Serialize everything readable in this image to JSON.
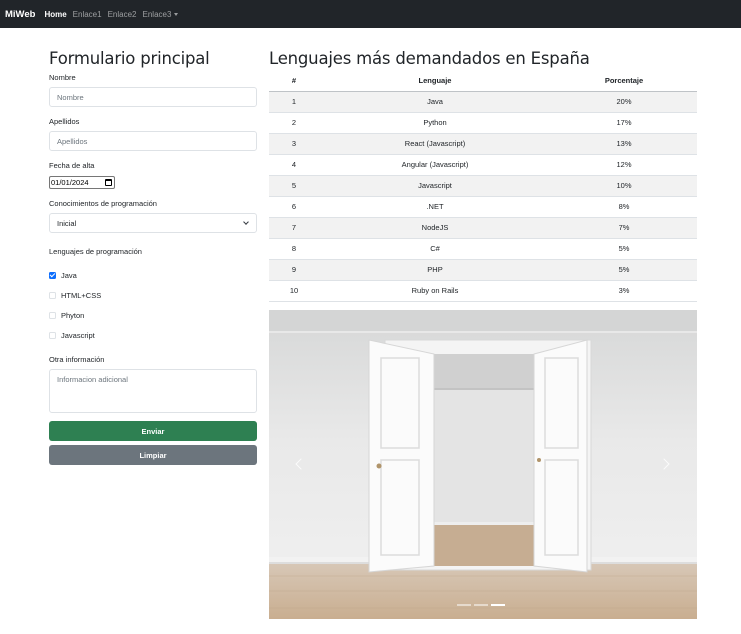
{
  "navbar": {
    "brand": "MiWeb",
    "links": [
      "Home",
      "Enlace1",
      "Enlace2",
      "Enlace3"
    ]
  },
  "form": {
    "title": "Formulario principal",
    "nombre_label": "Nombre",
    "nombre_placeholder": "Nombre",
    "apellidos_label": "Apellidos",
    "apellidos_placeholder": "Apellidos",
    "fecha_label": "Fecha de alta",
    "fecha_value": "01/01/2024",
    "conocimientos_label": "Conocimientos de programación",
    "conocimientos_value": "Inicial",
    "lenguajes_label": "Lenguajes de programación",
    "lenguajes": [
      {
        "label": "Java",
        "checked": true
      },
      {
        "label": "HTML+CSS",
        "checked": false
      },
      {
        "label": "Phyton",
        "checked": false
      },
      {
        "label": "Javascript",
        "checked": false
      }
    ],
    "otra_label": "Otra información",
    "otra_placeholder": "Informacion adicional",
    "enviar": "Enviar",
    "limpiar": "Limpiar"
  },
  "table": {
    "title": "Lenguajes más demandados en España",
    "headers": [
      "#",
      "Lenguaje",
      "Porcentaje"
    ],
    "rows": [
      [
        "1",
        "Java",
        "20%"
      ],
      [
        "2",
        "Python",
        "17%"
      ],
      [
        "3",
        "React (Javascript)",
        "13%"
      ],
      [
        "4",
        "Angular (Javascript)",
        "12%"
      ],
      [
        "5",
        "Javascript",
        "10%"
      ],
      [
        "6",
        ".NET",
        "8%"
      ],
      [
        "7",
        "NodeJS",
        "7%"
      ],
      [
        "8",
        "C#",
        "5%"
      ],
      [
        "9",
        "PHP",
        "5%"
      ],
      [
        "10",
        "Ruby on Rails",
        "3%"
      ]
    ]
  },
  "carousel": {
    "image": "room-with-open-white-double-doors",
    "slide_count": 3,
    "active_slide": 3,
    "prev_icon": "chevron-left-icon",
    "next_icon": "chevron-right-icon"
  },
  "colors": {
    "navbar_bg": "#212529",
    "accent": "#0d6efd",
    "btn_enviar": "#2e8052",
    "btn_limpiar": "#6c757d"
  }
}
